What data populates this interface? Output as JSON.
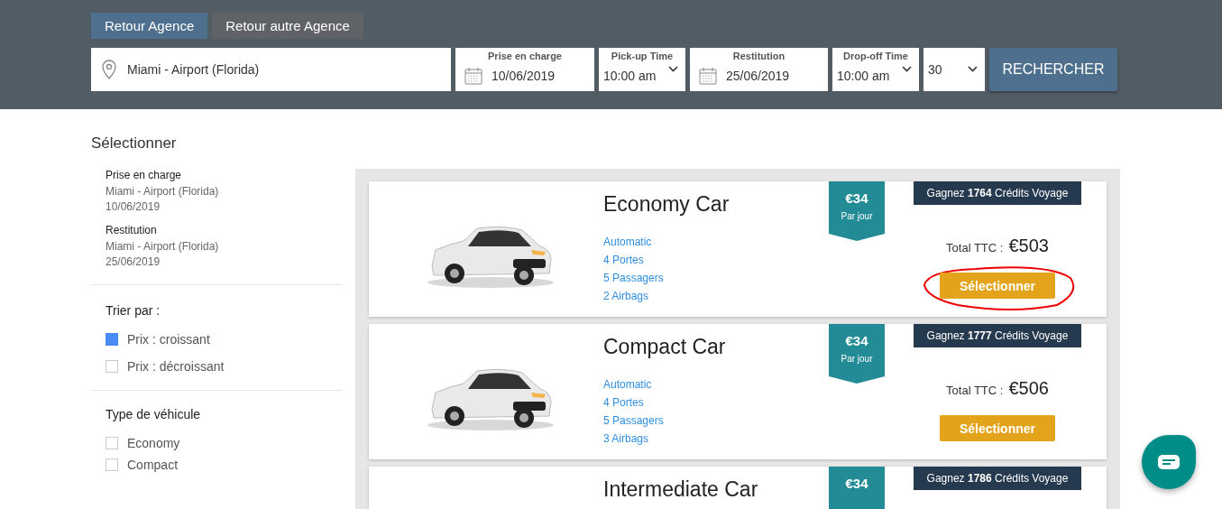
{
  "header": {
    "tabs": [
      {
        "label": "Retour Agence",
        "selected": true
      },
      {
        "label": "Retour autre Agence",
        "selected": false
      }
    ],
    "location": {
      "value": "Miami - Airport (Florida)"
    },
    "pickup_date": {
      "label": "Prise en charge",
      "value": "10/06/2019"
    },
    "pickup_time": {
      "label": "Pick-up Time",
      "value": "10:00 am"
    },
    "return_date": {
      "label": "Restitution",
      "value": "25/06/2019"
    },
    "dropoff_time": {
      "label": "Drop-off Time",
      "value": "10:00 am"
    },
    "age": {
      "value": "30"
    },
    "search_button": "RECHERCHER"
  },
  "sidebar": {
    "title": "Sélectionner",
    "summary": [
      {
        "label": "Prise en charge",
        "place": "Miami - Airport (Florida)",
        "date": "10/06/2019"
      },
      {
        "label": "Restitution",
        "place": "Miami - Airport (Florida)",
        "date": "25/06/2019"
      }
    ],
    "sort": {
      "title": "Trier par :",
      "options": [
        {
          "label": "Prix : croissant",
          "checked": true
        },
        {
          "label": "Prix : décroissant",
          "checked": false
        }
      ]
    },
    "vehicle_type": {
      "title": "Type de véhicule",
      "options": [
        {
          "label": "Economy",
          "checked": false
        },
        {
          "label": "Compact",
          "checked": false
        }
      ]
    }
  },
  "offers": [
    {
      "name": "Economy Car",
      "features": [
        "Automatic",
        "4 Portes",
        "5 Passagers",
        "2 Airbags"
      ],
      "daily_price": "€34",
      "per_day": "Par jour",
      "credits": "Gagnez **1764** Crédits Voyage",
      "total_label": "Total TTC :",
      "total": "€503",
      "button": "Sélectionner",
      "circled": true
    },
    {
      "name": "Compact Car",
      "features": [
        "Automatic",
        "4 Portes",
        "5 Passagers",
        "3 Airbags"
      ],
      "daily_price": "€34",
      "per_day": "Par jour",
      "credits": "Gagnez **1777** Crédits Voyage",
      "total_label": "Total TTC :",
      "total": "€506",
      "button": "Sélectionner",
      "circled": false
    },
    {
      "name": "Intermediate Car",
      "daily_price": "€34",
      "credits": "Gagnez **1786** Crédits Voyage",
      "circled": false
    }
  ]
}
